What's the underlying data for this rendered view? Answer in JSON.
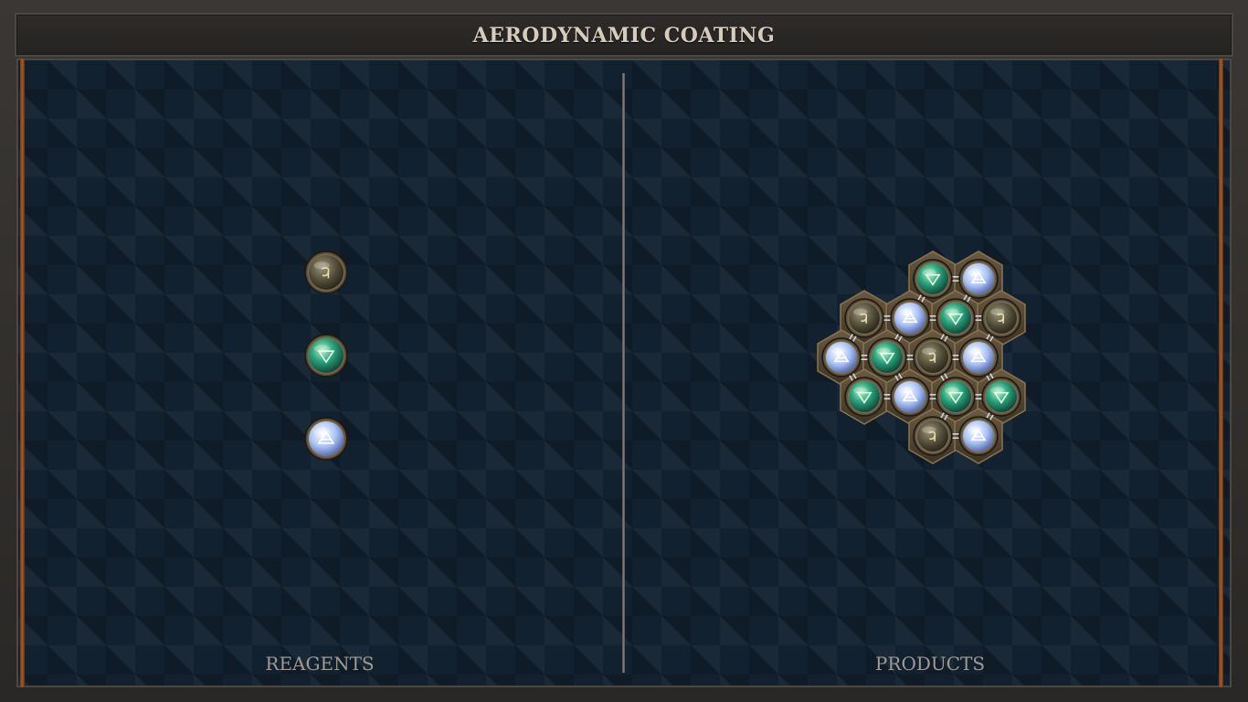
{
  "header": {
    "title": "AERODYNAMIC COATING"
  },
  "labels": {
    "reagents": "REAGENTS",
    "products": "PRODUCTS"
  },
  "colors": {
    "salt_atom": "#5f5a43",
    "water_atom": "#27a07c",
    "air_atom": "#9fb7ee",
    "copper_edge": "#a35d2d",
    "board_bg": "#122130"
  },
  "element_symbols": {
    "salt": "salt-symbol-icon",
    "water": "water-symbol-icon",
    "air": "air-symbol-icon"
  },
  "reagents": [
    {
      "element": "salt"
    },
    {
      "element": "water"
    },
    {
      "element": "air"
    }
  ],
  "product": {
    "atoms": [
      {
        "element": "water",
        "row": 0,
        "col": 0
      },
      {
        "element": "air",
        "row": 0,
        "col": 1
      },
      {
        "element": "salt",
        "row": 1,
        "col": 0
      },
      {
        "element": "air",
        "row": 1,
        "col": 1
      },
      {
        "element": "water",
        "row": 1,
        "col": 2
      },
      {
        "element": "salt",
        "row": 1,
        "col": 3
      },
      {
        "element": "air",
        "row": 2,
        "col": 0
      },
      {
        "element": "water",
        "row": 2,
        "col": 1
      },
      {
        "element": "salt",
        "row": 2,
        "col": 2
      },
      {
        "element": "air",
        "row": 2,
        "col": 3
      },
      {
        "element": "water",
        "row": 3,
        "col": 0
      },
      {
        "element": "air",
        "row": 3,
        "col": 1
      },
      {
        "element": "water",
        "row": 3,
        "col": 2
      },
      {
        "element": "water",
        "row": 3,
        "col": 3
      },
      {
        "element": "salt",
        "row": 4,
        "col": 0
      },
      {
        "element": "air",
        "row": 4,
        "col": 1
      }
    ],
    "bonds": [
      [
        0,
        1
      ],
      [
        0,
        3
      ],
      [
        1,
        4
      ],
      [
        2,
        3
      ],
      [
        3,
        4
      ],
      [
        4,
        5
      ],
      [
        2,
        6
      ],
      [
        3,
        7
      ],
      [
        4,
        8
      ],
      [
        5,
        9
      ],
      [
        6,
        7
      ],
      [
        7,
        8
      ],
      [
        8,
        9
      ],
      [
        6,
        10
      ],
      [
        7,
        11
      ],
      [
        8,
        12
      ],
      [
        9,
        13
      ],
      [
        10,
        11
      ],
      [
        11,
        12
      ],
      [
        12,
        13
      ],
      [
        12,
        14
      ],
      [
        14,
        15
      ],
      [
        13,
        15
      ]
    ]
  }
}
